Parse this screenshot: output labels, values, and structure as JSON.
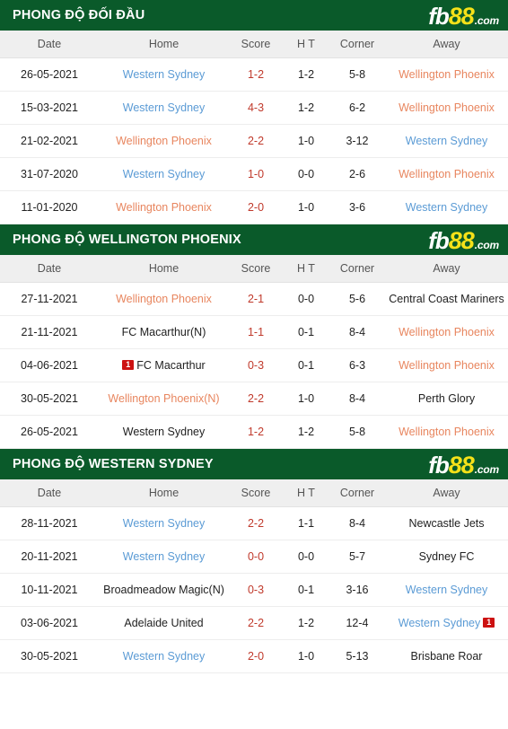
{
  "logo": {
    "part1": "fb",
    "part2": "88",
    "part3": ".com"
  },
  "columns": {
    "date": "Date",
    "home": "Home",
    "score": "Score",
    "ht": "H T",
    "corner": "Corner",
    "away": "Away"
  },
  "colors": {
    "header_green": "#0a5a2a",
    "logo_yellow": "#f5e119",
    "score_red": "#c0392b",
    "team_blue": "#5b9bd5",
    "team_orange": "#e8865f",
    "card_red": "#cc1111",
    "col_head_bg": "#efefef"
  },
  "sections": [
    {
      "title": "PHONG ĐỘ ĐỐI ĐẦU",
      "rows": [
        {
          "date": "26-05-2021",
          "home": "Western Sydney",
          "home_style": "t-blue",
          "home_card": "",
          "score": "1-2",
          "ht": "1-2",
          "corner": "5-8",
          "away": "Wellington Phoenix",
          "away_style": "t-orange",
          "away_card": ""
        },
        {
          "date": "15-03-2021",
          "home": "Western Sydney",
          "home_style": "t-blue",
          "home_card": "",
          "score": "4-3",
          "ht": "1-2",
          "corner": "6-2",
          "away": "Wellington Phoenix",
          "away_style": "t-orange",
          "away_card": ""
        },
        {
          "date": "21-02-2021",
          "home": "Wellington Phoenix",
          "home_style": "t-orange",
          "home_card": "",
          "score": "2-2",
          "ht": "1-0",
          "corner": "3-12",
          "away": "Western Sydney",
          "away_style": "t-blue",
          "away_card": ""
        },
        {
          "date": "31-07-2020",
          "home": "Western Sydney",
          "home_style": "t-blue",
          "home_card": "",
          "score": "1-0",
          "ht": "0-0",
          "corner": "2-6",
          "away": "Wellington Phoenix",
          "away_style": "t-orange",
          "away_card": ""
        },
        {
          "date": "11-01-2020",
          "home": "Wellington Phoenix",
          "home_style": "t-orange",
          "home_card": "",
          "score": "2-0",
          "ht": "1-0",
          "corner": "3-6",
          "away": "Western Sydney",
          "away_style": "t-blue",
          "away_card": ""
        }
      ]
    },
    {
      "title": "PHONG ĐỘ WELLINGTON PHOENIX",
      "rows": [
        {
          "date": "27-11-2021",
          "home": "Wellington Phoenix",
          "home_style": "t-orange",
          "home_card": "",
          "score": "2-1",
          "ht": "0-0",
          "corner": "5-6",
          "away": "Central Coast Mariners",
          "away_style": "t-dark",
          "away_card": ""
        },
        {
          "date": "21-11-2021",
          "home": "FC Macarthur(N)",
          "home_style": "t-dark",
          "home_card": "",
          "score": "1-1",
          "ht": "0-1",
          "corner": "8-4",
          "away": "Wellington Phoenix",
          "away_style": "t-orange",
          "away_card": ""
        },
        {
          "date": "04-06-2021",
          "home": "FC Macarthur",
          "home_style": "t-dark",
          "home_card": "1",
          "score": "0-3",
          "ht": "0-1",
          "corner": "6-3",
          "away": "Wellington Phoenix",
          "away_style": "t-orange",
          "away_card": ""
        },
        {
          "date": "30-05-2021",
          "home": "Wellington Phoenix(N)",
          "home_style": "t-orange",
          "home_card": "",
          "score": "2-2",
          "ht": "1-0",
          "corner": "8-4",
          "away": "Perth Glory",
          "away_style": "t-dark",
          "away_card": ""
        },
        {
          "date": "26-05-2021",
          "home": "Western Sydney",
          "home_style": "t-dark",
          "home_card": "",
          "score": "1-2",
          "ht": "1-2",
          "corner": "5-8",
          "away": "Wellington Phoenix",
          "away_style": "t-orange",
          "away_card": ""
        }
      ]
    },
    {
      "title": "PHONG ĐỘ WESTERN SYDNEY",
      "rows": [
        {
          "date": "28-11-2021",
          "home": "Western Sydney",
          "home_style": "t-blue",
          "home_card": "",
          "score": "2-2",
          "ht": "1-1",
          "corner": "8-4",
          "away": "Newcastle Jets",
          "away_style": "t-dark",
          "away_card": ""
        },
        {
          "date": "20-11-2021",
          "home": "Western Sydney",
          "home_style": "t-blue",
          "home_card": "",
          "score": "0-0",
          "ht": "0-0",
          "corner": "5-7",
          "away": "Sydney FC",
          "away_style": "t-dark",
          "away_card": ""
        },
        {
          "date": "10-11-2021",
          "home": "Broadmeadow Magic(N)",
          "home_style": "t-dark",
          "home_card": "",
          "score": "0-3",
          "ht": "0-1",
          "corner": "3-16",
          "away": "Western Sydney",
          "away_style": "t-blue",
          "away_card": ""
        },
        {
          "date": "03-06-2021",
          "home": "Adelaide United",
          "home_style": "t-dark",
          "home_card": "",
          "score": "2-2",
          "ht": "1-2",
          "corner": "12-4",
          "away": "Western Sydney",
          "away_style": "t-blue",
          "away_card": "1"
        },
        {
          "date": "30-05-2021",
          "home": "Western Sydney",
          "home_style": "t-blue",
          "home_card": "",
          "score": "2-0",
          "ht": "1-0",
          "corner": "5-13",
          "away": "Brisbane Roar",
          "away_style": "t-dark",
          "away_card": ""
        }
      ]
    }
  ]
}
